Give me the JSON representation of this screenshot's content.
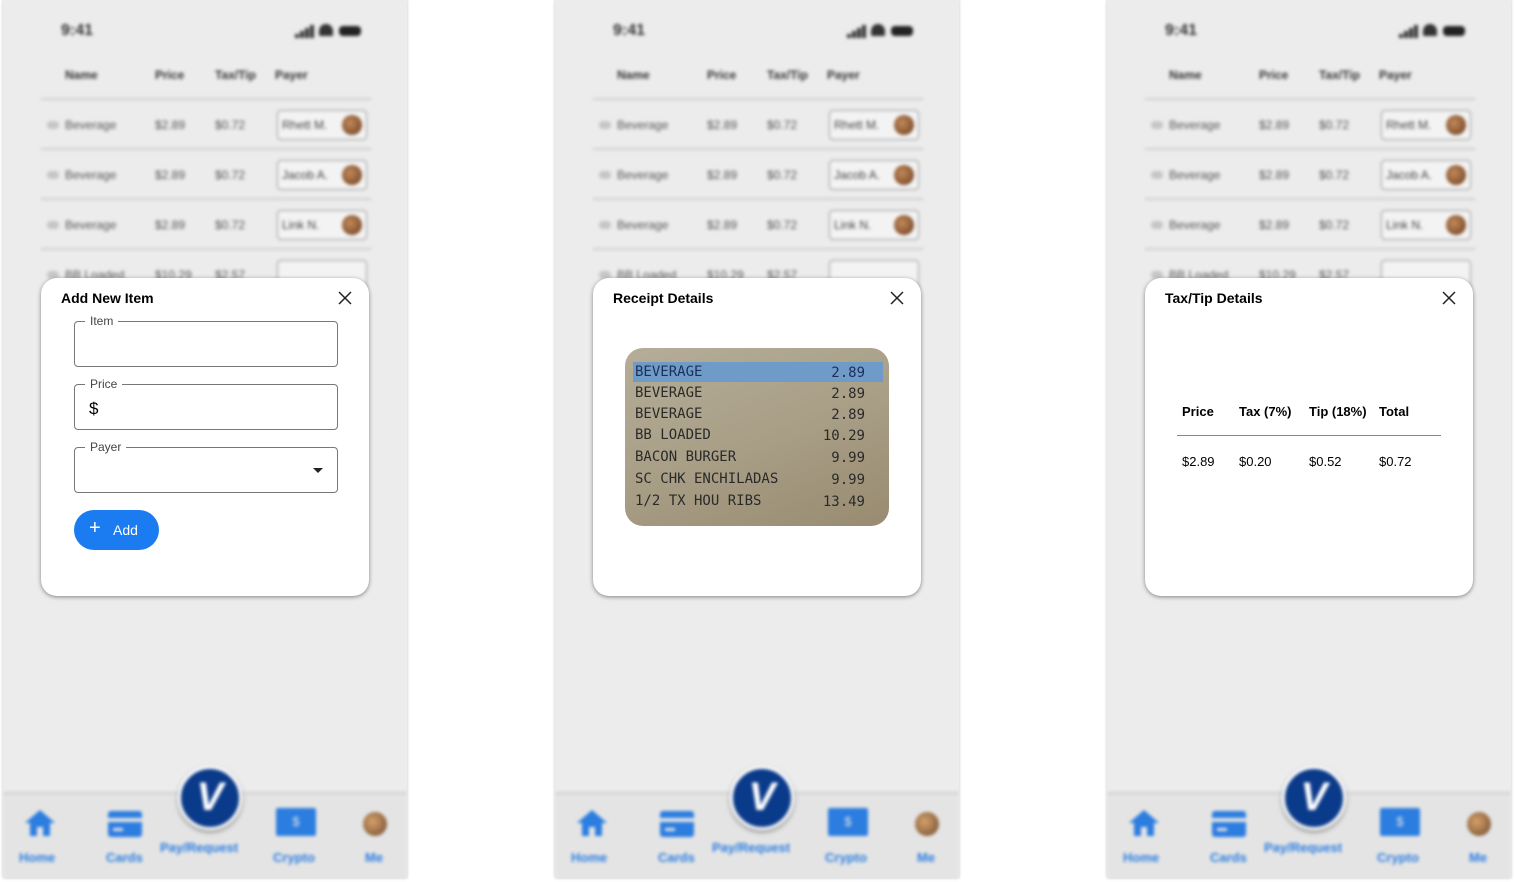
{
  "status": {
    "time": "9:41"
  },
  "table": {
    "headers": {
      "name": "Name",
      "price": "Price",
      "taxtip": "Tax/Tip",
      "payer": "Payer"
    },
    "rows": [
      {
        "name": "Beverage",
        "price": "$2.89",
        "taxtip": "$0.72",
        "payer": "Rhett M."
      },
      {
        "name": "Beverage",
        "price": "$2.89",
        "taxtip": "$0.72",
        "payer": "Jacob A."
      },
      {
        "name": "Beverage",
        "price": "$2.89",
        "taxtip": "$0.72",
        "payer": "Link N."
      },
      {
        "name": "BB Loaded",
        "price": "$10.29",
        "taxtip": "$2.57",
        "payer": ""
      }
    ]
  },
  "tabs": {
    "home": "Home",
    "cards": "Cards",
    "pay": "Pay/Request",
    "crypto": "Crypto",
    "me": "Me",
    "logo": "V",
    "crypto_badge": "$"
  },
  "add_modal": {
    "title": "Add New Item",
    "item_label": "Item",
    "price_label": "Price",
    "price_prefix": "$",
    "payer_label": "Payer",
    "add_button": "Add",
    "add_icon": "+"
  },
  "receipt_modal": {
    "title": "Receipt Details",
    "lines": [
      {
        "item": "BEVERAGE",
        "price": "2.89"
      },
      {
        "item": "BEVERAGE",
        "price": "2.89"
      },
      {
        "item": "BEVERAGE",
        "price": "2.89"
      },
      {
        "item": "BB LOADED",
        "price": "10.29"
      },
      {
        "item": "BACON BURGER",
        "price": "9.99"
      },
      {
        "item": "SC CHK ENCHILADAS",
        "price": "9.99"
      },
      {
        "item": "1/2 TX HOU RIBS",
        "price": "13.49"
      }
    ]
  },
  "tax_modal": {
    "title": "Tax/Tip Details",
    "headers": {
      "price": "Price",
      "tax": "Tax (7%)",
      "tip": "Tip (18%)",
      "total": "Total"
    },
    "values": {
      "price": "$2.89",
      "tax": "$0.20",
      "tip": "$0.52",
      "total": "$0.72"
    }
  },
  "colors": {
    "accent": "#1a7cf0",
    "brand": "#0a3a8a",
    "highlight": "#6f9bc9"
  }
}
